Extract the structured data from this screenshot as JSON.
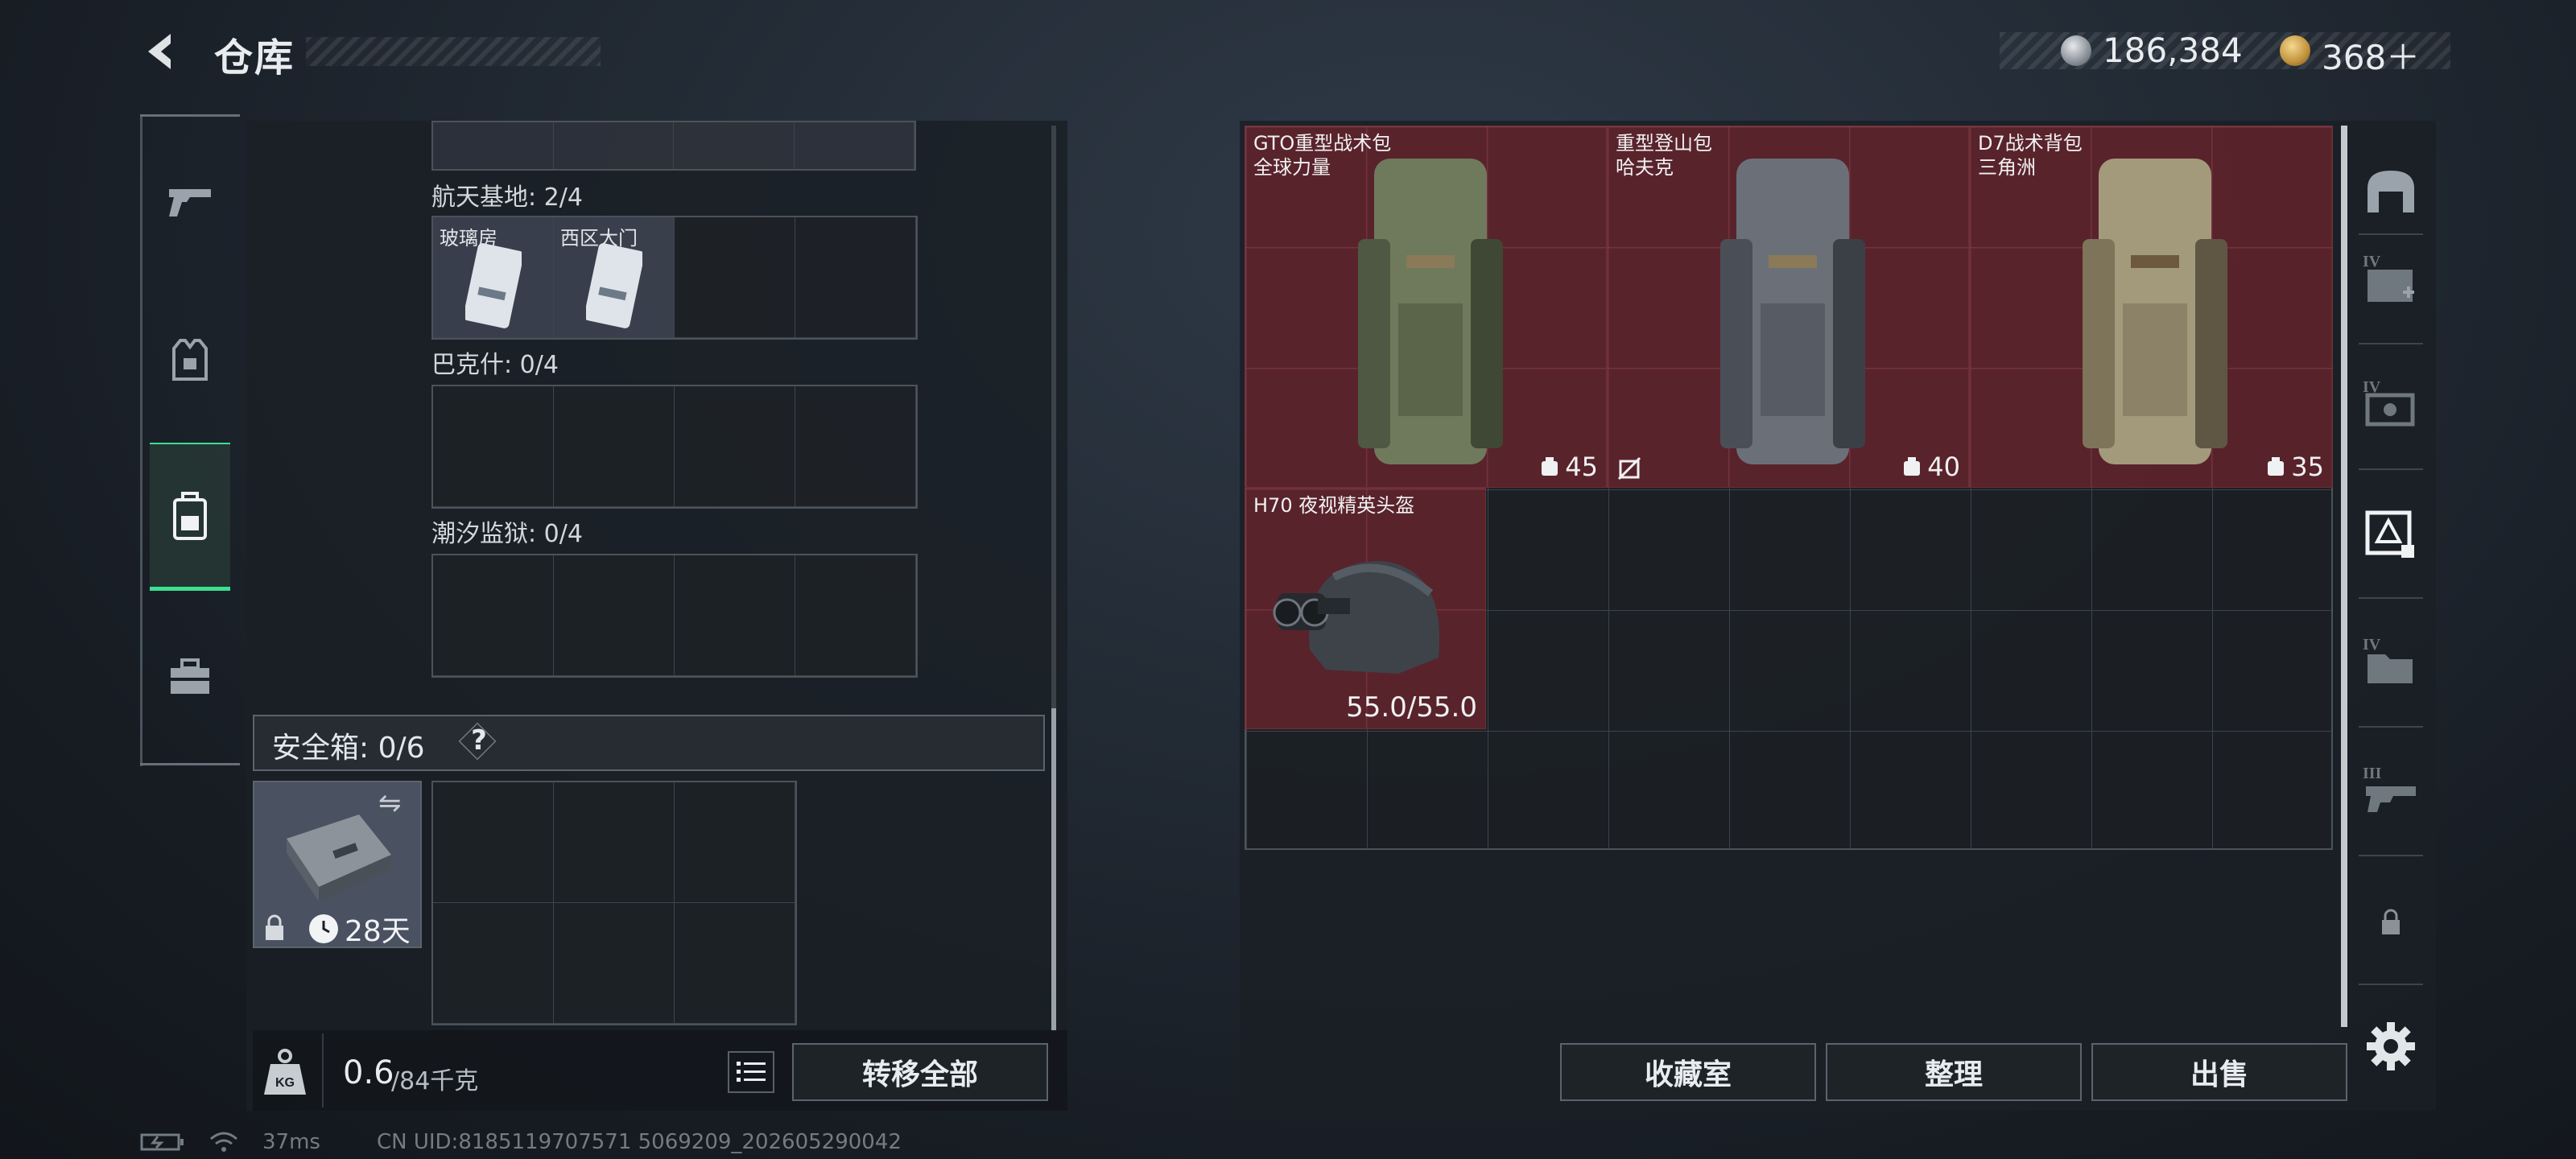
{
  "header": {
    "title": "仓库",
    "currency_silver": "186,384",
    "currency_gold": "368＋"
  },
  "left_rail": {
    "items": [
      {
        "name": "weapons",
        "icon": "pistol-icon"
      },
      {
        "name": "armor",
        "icon": "vest-icon"
      },
      {
        "name": "backpacks",
        "icon": "backpack-icon",
        "selected": true
      },
      {
        "name": "tools",
        "icon": "toolbox-icon"
      }
    ]
  },
  "keys": {
    "aerospace_label": "航天基地: 2/4",
    "aerospace_slots": [
      {
        "label": "玻璃房",
        "filled": true
      },
      {
        "label": "西区大门",
        "filled": true
      },
      {
        "label": "",
        "filled": false
      },
      {
        "label": "",
        "filled": false
      }
    ],
    "bakhmut_label": "巴克什: 0/4",
    "prison_label": "潮汐监狱: 0/4"
  },
  "safe_box": {
    "label": "安全箱: 0/6",
    "help": "?",
    "swap_symbol": "⇋",
    "days_left": "28天"
  },
  "weight": {
    "current": "0.6",
    "max": "/84千克",
    "transfer_all": "转移全部"
  },
  "stash_items": [
    {
      "id": "gto",
      "name_line1": "GTO重型战术包",
      "name_line2": "全球力量",
      "count": "45",
      "count_icon": "capacity-icon"
    },
    {
      "id": "climb",
      "name_line1": "重型登山包",
      "name_line2": "哈夫克",
      "count": "40",
      "count_icon": "capacity-icon",
      "extra_icon": "no-trade-icon"
    },
    {
      "id": "d7",
      "name_line1": "D7战术背包",
      "name_line2": "三角洲",
      "count": "35",
      "count_icon": "capacity-icon"
    },
    {
      "id": "h70",
      "name_line1": "H70 夜视精英头盔",
      "durability": "55.0/55.0"
    }
  ],
  "bottom_buttons": {
    "collection": "收藏室",
    "organize": "整理",
    "sell": "出售"
  },
  "right_rail": {
    "items": [
      {
        "name": "stash-main",
        "icon": "vault-icon"
      },
      {
        "name": "expansion-1",
        "icon": "medical-case-icon",
        "badge": "IV"
      },
      {
        "name": "expansion-2",
        "icon": "ammo-case-icon",
        "badge": "IV"
      },
      {
        "name": "expansion-3",
        "icon": "equipment-case-icon",
        "badge": "",
        "selected": true
      },
      {
        "name": "expansion-4",
        "icon": "folder-case-icon",
        "badge": "IV"
      },
      {
        "name": "expansion-5",
        "icon": "weapon-case-icon",
        "badge": "III"
      },
      {
        "name": "expansion-locked",
        "icon": "lock-icon"
      }
    ]
  },
  "status_bar": {
    "ping": "37ms",
    "uid": "CN UID:8185119707571 5069209_202605290042"
  },
  "colors": {
    "accent_green": "#3ce08f",
    "item_red": "#6e242e",
    "panel": "#1a1f25"
  }
}
